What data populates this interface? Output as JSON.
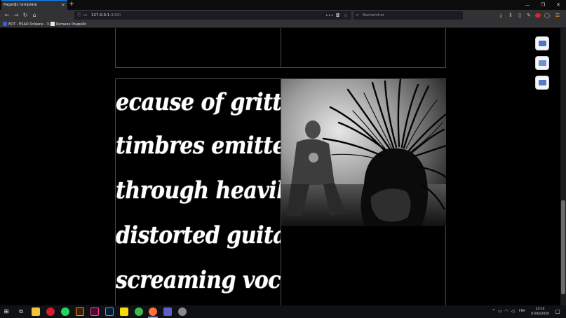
{
  "browser": {
    "tab_title": "PagedJs template",
    "tab_close": "×",
    "new_tab": "+",
    "win_minimize": "—",
    "win_restore": "❐",
    "win_close": "✕"
  },
  "navbar": {
    "back": "←",
    "forward": "→",
    "reload": "↻",
    "home": "⌂",
    "url_host": "127.0.0.1",
    "url_port": ":3000",
    "more_actions": "•••",
    "search_placeholder": "Rechercher"
  },
  "bookmarks": [
    {
      "label": "EDT - ÉSAD Orléans - 3...",
      "icon_color": "#3b5bd6"
    },
    {
      "label": "Romane Poupelin",
      "icon_color": "#e6e6e6"
    }
  ],
  "content": {
    "text_lines": [
      "ecause of gritty",
      "timbres emitted",
      "through heavily",
      "distorted guitars,",
      "screaming vocals,"
    ]
  },
  "taskbar": {
    "language": "FRA",
    "time": "13:14",
    "date": "07/04/2020"
  },
  "colors": {
    "accent": "#0a84ff",
    "toolbar": "#323234",
    "page_bg": "#000000"
  }
}
